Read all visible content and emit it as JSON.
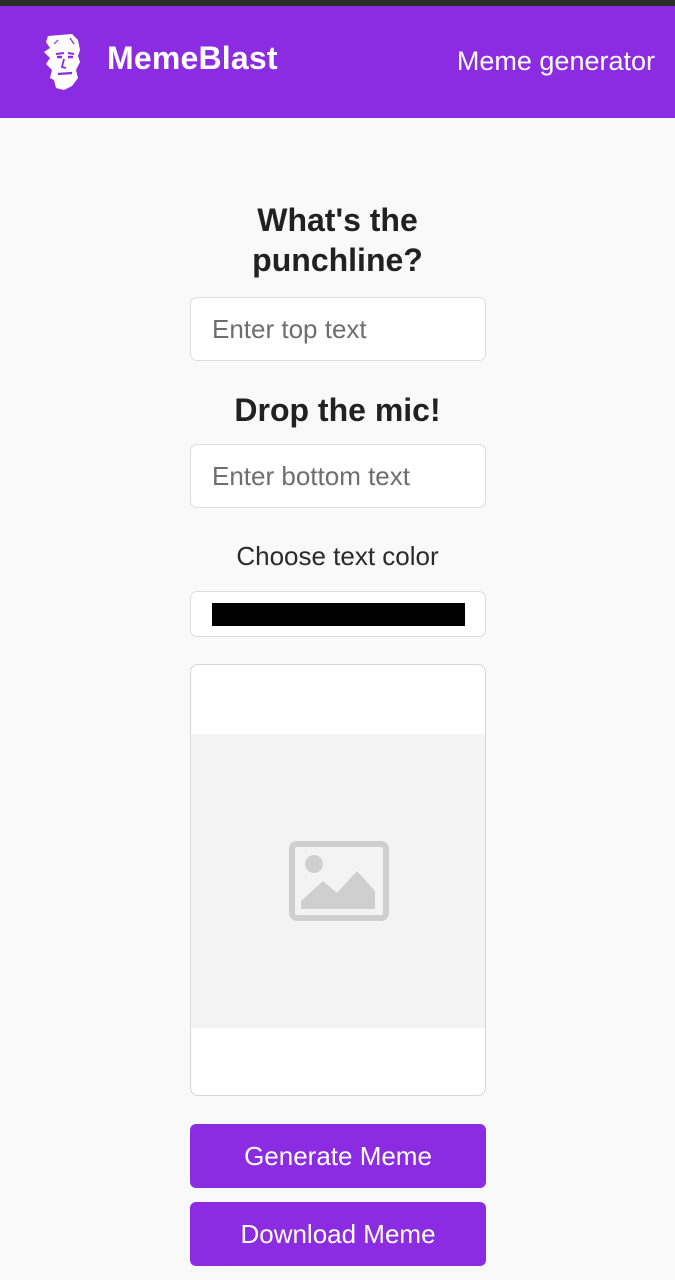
{
  "colors": {
    "brand": "#8b2be2",
    "page_background": "#f9f9f9",
    "text_color_value": "#000000"
  },
  "header": {
    "logo_icon": "face-silhouette-icon",
    "brand": "MemeBlast",
    "subtitle": "Meme generator"
  },
  "form": {
    "top_heading": "What's the punchline?",
    "top_input": {
      "placeholder": "Enter top text",
      "value": ""
    },
    "bottom_heading": "Drop the mic!",
    "bottom_input": {
      "placeholder": "Enter bottom text",
      "value": ""
    },
    "color_heading": "Choose text color",
    "color_value": "#000000"
  },
  "preview": {
    "placeholder_icon": "image-placeholder-icon"
  },
  "actions": {
    "generate_label": "Generate Meme",
    "download_label": "Download Meme"
  }
}
